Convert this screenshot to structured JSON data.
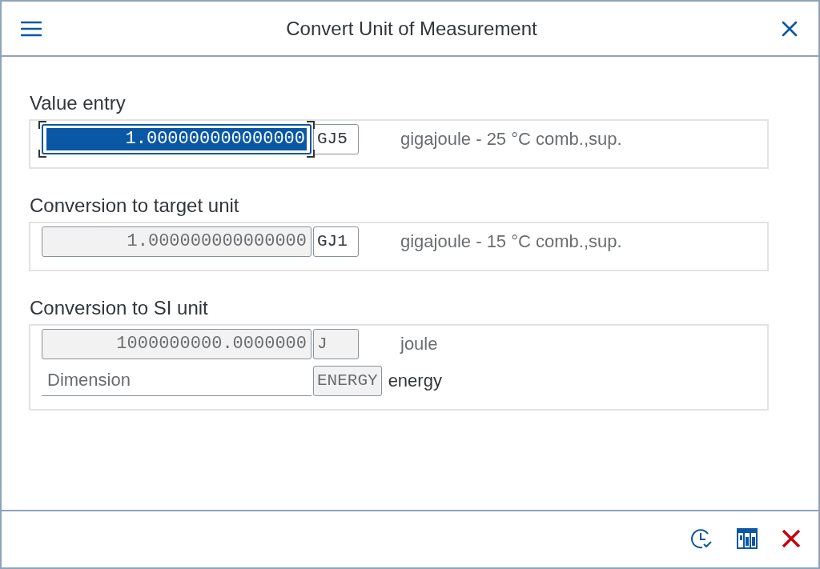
{
  "window": {
    "title": "Convert Unit of Measurement"
  },
  "sections": [
    {
      "title": "Value entry",
      "rows": [
        {
          "kind": "value",
          "value": "1.000000000000000",
          "readonly": false,
          "focused": true,
          "unit": "GJ5",
          "unit_readonly": false,
          "description": "gigajoule - 25 °C comb.,sup."
        }
      ]
    },
    {
      "title": "Conversion to target unit",
      "rows": [
        {
          "kind": "value",
          "value": "1.000000000000000",
          "readonly": true,
          "focused": false,
          "unit": "GJ1",
          "unit_readonly": false,
          "description": "gigajoule - 15 °C comb.,sup."
        }
      ]
    },
    {
      "title": "Conversion to SI unit",
      "rows": [
        {
          "kind": "value",
          "value": "1000000000.0000000",
          "readonly": true,
          "focused": false,
          "unit": "J",
          "unit_readonly": true,
          "description": "joule"
        },
        {
          "kind": "label",
          "placeholder": "Dimension",
          "unit": "ENERGY",
          "unit_readonly": true,
          "description": "energy"
        }
      ]
    }
  ]
}
